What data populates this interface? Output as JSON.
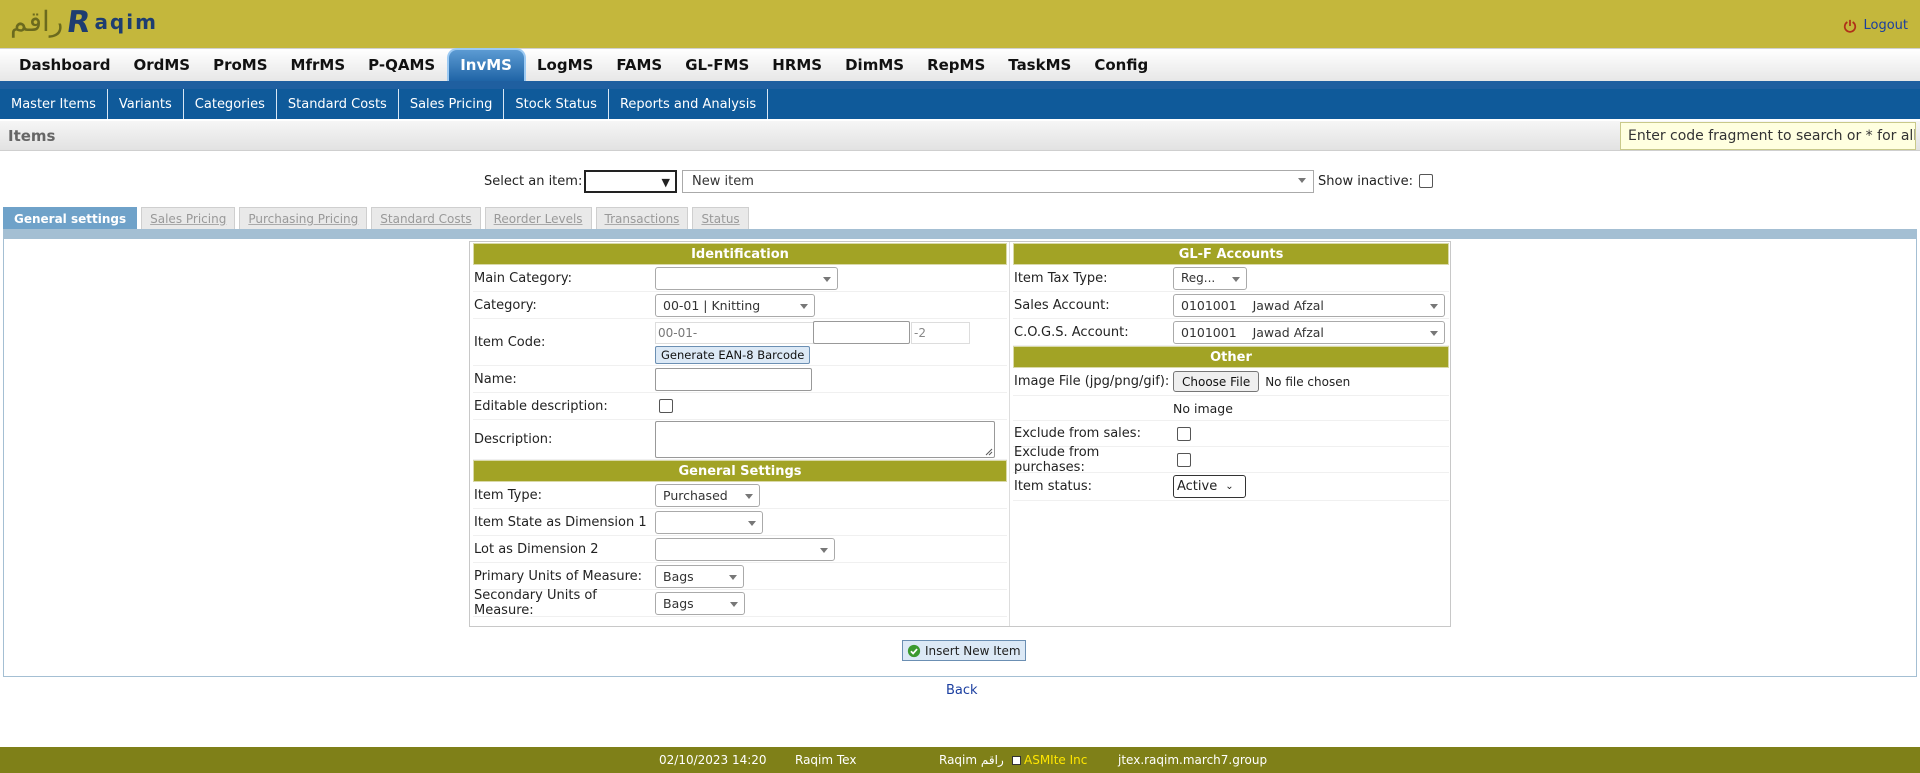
{
  "header": {
    "logo_arabic": "راقم",
    "logo_text": "aqim",
    "logo_initial": "R",
    "logout_label": "Logout"
  },
  "main_nav": {
    "tabs": [
      {
        "label": "Dashboard"
      },
      {
        "label": "OrdMS"
      },
      {
        "label": "ProMS"
      },
      {
        "label": "MfrMS"
      },
      {
        "label": "P-QAMS"
      },
      {
        "label": "InvMS",
        "active": true
      },
      {
        "label": "LogMS"
      },
      {
        "label": "FAMS"
      },
      {
        "label": "GL-FMS"
      },
      {
        "label": "HRMS"
      },
      {
        "label": "DimMS"
      },
      {
        "label": "RepMS"
      },
      {
        "label": "TaskMS"
      },
      {
        "label": "Config"
      }
    ]
  },
  "sub_nav": {
    "items": [
      {
        "label": "Master Items"
      },
      {
        "label": "Variants"
      },
      {
        "label": "Categories"
      },
      {
        "label": "Standard Costs"
      },
      {
        "label": "Sales Pricing"
      },
      {
        "label": "Stock Status"
      },
      {
        "label": "Reports and Analysis"
      }
    ]
  },
  "page": {
    "title": "Items",
    "search_hint": "Enter code fragment to search or * for all"
  },
  "selector": {
    "select_label": "Select an item:",
    "item_code_value": "",
    "item_name_value": "New item",
    "show_inactive_label": "Show inactive:",
    "show_inactive_checked": false
  },
  "content_tabs": [
    {
      "label": "General settings",
      "active": true
    },
    {
      "label": "Sales Pricing"
    },
    {
      "label": "Purchasing Pricing"
    },
    {
      "label": "Standard Costs"
    },
    {
      "label": "Reorder Levels"
    },
    {
      "label": "Transactions"
    },
    {
      "label": "Status"
    }
  ],
  "identification": {
    "header": "Identification",
    "main_category_label": "Main Category:",
    "main_category_value": "",
    "category_label": "Category:",
    "category_value": "00-01 | Knitting",
    "item_code_label": "Item Code:",
    "item_code_prefix": "00-01-",
    "item_code_value": "",
    "item_code_suffix": "-2",
    "generate_barcode_label": "Generate EAN-8 Barcode",
    "name_label": "Name:",
    "name_value": "",
    "editable_desc_label": "Editable description:",
    "editable_desc_checked": false,
    "description_label": "Description:",
    "description_value": ""
  },
  "general_settings": {
    "header": "General Settings",
    "item_type_label": "Item Type:",
    "item_type_value": "Purchased",
    "dim1_label": "Item State as Dimension 1",
    "dim1_value": "",
    "dim2_label": "Lot as Dimension 2",
    "dim2_value": "",
    "primary_uom_label": "Primary Units of Measure:",
    "primary_uom_value": "Bags",
    "secondary_uom_label": "Secondary Units of Measure:",
    "secondary_uom_value": "Bags"
  },
  "gl_accounts": {
    "header": "GL-F Accounts",
    "tax_type_label": "Item Tax Type:",
    "tax_type_value": "Reg...",
    "sales_account_label": "Sales Account:",
    "sales_account_value": "0101001    Jawad Afzal",
    "cogs_account_label": "C.O.G.S. Account:",
    "cogs_account_value": "0101001    Jawad Afzal"
  },
  "other": {
    "header": "Other",
    "image_file_label": "Image File (jpg/png/gif):",
    "choose_file_label": "Choose File",
    "no_file_label": "No file chosen",
    "no_image_label": "No image",
    "exclude_sales_label": "Exclude from sales:",
    "exclude_sales_checked": false,
    "exclude_purchases_label": "Exclude from purchases:",
    "exclude_purchases_checked": false,
    "item_status_label": "Item status:",
    "item_status_value": "Active"
  },
  "actions": {
    "insert_label": "Insert New Item",
    "back_label": "Back"
  },
  "footer": {
    "datetime": "02/10/2023 14:20",
    "company": "Raqim Tex",
    "brand": "Raqim راقم",
    "vendor": "ASMIte Inc",
    "host": "jtex.raqim.march7.group"
  },
  "colors": {
    "header_bg": "#c4b73c",
    "subnav_bg": "#0f5a9a",
    "section_head": "#a2a325",
    "footer_bg": "#7f8018",
    "active_tab": "#6fa2c9"
  }
}
